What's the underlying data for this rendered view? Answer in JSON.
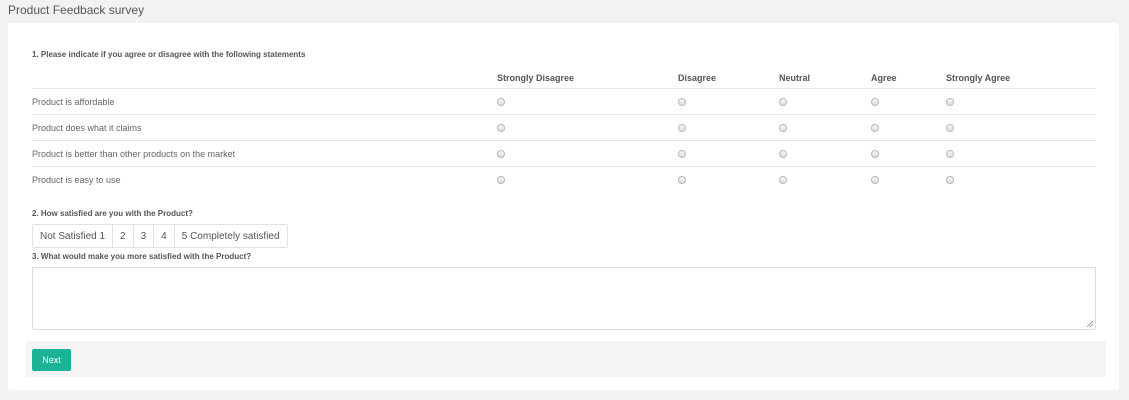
{
  "page": {
    "title": "Product Feedback survey"
  },
  "q1": {
    "title": "1. Please indicate if you agree or disagree with the following statements",
    "columns": [
      "Strongly Disagree",
      "Disagree",
      "Neutral",
      "Agree",
      "Strongly Agree"
    ],
    "rows": [
      "Product is affordable",
      "Product does what it claims",
      "Product is better than other products on the market",
      "Product is easy to use"
    ]
  },
  "q2": {
    "title": "2. How satisfied are you with the Product?",
    "options": [
      "Not Satisfied 1",
      "2",
      "3",
      "4",
      "5 Completely satisfied"
    ]
  },
  "q3": {
    "title": "3. What would make you more satisfied with the Product?",
    "value": ""
  },
  "footer": {
    "next_label": "Next"
  },
  "colors": {
    "accent": "#1ab394"
  }
}
